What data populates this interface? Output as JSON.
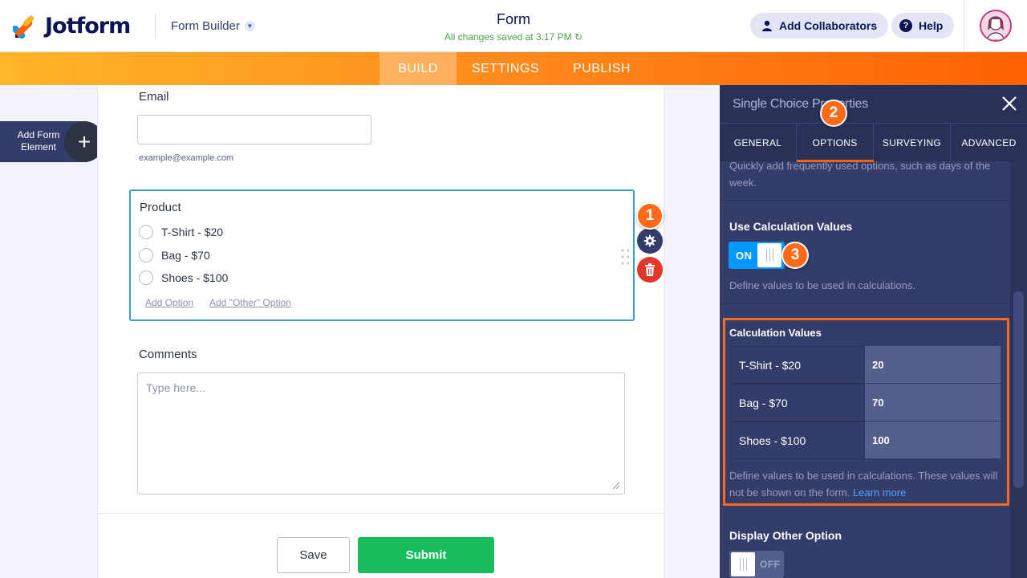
{
  "header": {
    "logo_text": "Jotform",
    "builder_mode": "Form Builder",
    "form_title": "Form",
    "save_status": "All changes saved at 3:17 PM",
    "add_collaborators": "Add Collaborators",
    "help": "Help"
  },
  "nav": {
    "build": "BUILD",
    "settings": "SETTINGS",
    "publish": "PUBLISH"
  },
  "sidebar": {
    "add_element_label": "Add Form Element"
  },
  "form": {
    "email_label": "Email",
    "email_value": "",
    "email_sublabel": "example@example.com",
    "product_label": "Product",
    "options": [
      "T-Shirt - $20",
      "Bag - $70",
      "Shoes - $100"
    ],
    "add_option": "Add Option",
    "add_other_option": "Add \"Other\" Option",
    "comments_label": "Comments",
    "comments_placeholder": "Type here...",
    "save_button": "Save",
    "submit_button": "Submit"
  },
  "badges": [
    "1",
    "2",
    "3"
  ],
  "panel": {
    "title": "Single Choice Properties",
    "tabs": [
      "GENERAL",
      "OPTIONS",
      "SURVEYING",
      "ADVANCED"
    ],
    "active_tab": "OPTIONS",
    "top_hint": "Quickly add frequently used options, such as days of the week.",
    "use_calc_heading": "Use Calculation Values",
    "use_calc_toggle": "ON",
    "use_calc_desc": "Define values to be used in calculations.",
    "calc_values_heading": "Calculation Values",
    "calc_values": [
      {
        "option": "T-Shirt - $20",
        "value": "20"
      },
      {
        "option": "Bag - $70",
        "value": "70"
      },
      {
        "option": "Shoes - $100",
        "value": "100"
      }
    ],
    "calc_desc": "Define values to be used in calculations. These values will not be shown on the form.",
    "learn_more": "Learn more",
    "display_other_heading": "Display Other Option",
    "display_other_toggle": "OFF"
  },
  "colors": {
    "accent_orange": "#ff6100",
    "submit_green": "#18bd5b",
    "toggle_blue": "#0099ff",
    "panel_bg": "#343c6a"
  }
}
